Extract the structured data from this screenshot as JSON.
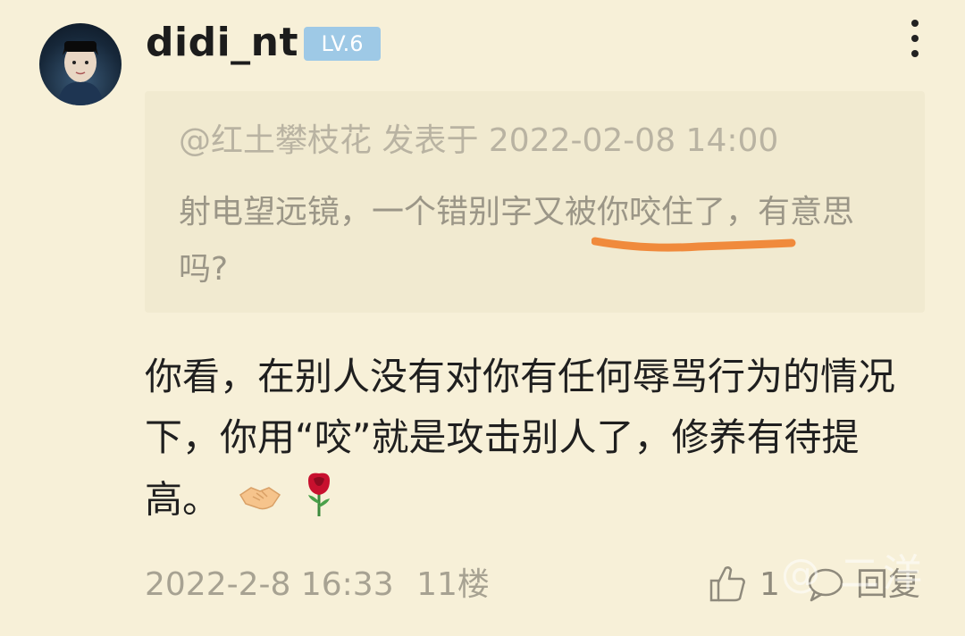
{
  "post": {
    "username": "didi_nt",
    "level": "LV.6",
    "more_icon": "more-vertical-icon",
    "avatar_icon": "avatar"
  },
  "quote": {
    "header": "@红土攀枝花 发表于 2022-02-08 14:00",
    "text": "射电望远镜，一个错别字又被你咬住了，有意思吗?",
    "highlight_color": "#f08a3c"
  },
  "comment": {
    "text": "你看，在别人没有对你有任何辱骂行为的情况下，你用“咬”就是攻击别人了，修养有待提高。",
    "emojis": [
      "handshake-icon",
      "rose-icon"
    ]
  },
  "footer": {
    "date": "2022-2-8 16:33",
    "floor": "11楼",
    "like_count": "1",
    "reply_label": "回复",
    "like_icon": "thumbs-up-icon",
    "reply_icon": "comment-bubble-icon"
  },
  "watermark": {
    "text": "@ 二洋"
  },
  "colors": {
    "background": "#f7f0d8",
    "quote_background": "#f1ead0",
    "badge": "#9ec9e6"
  }
}
